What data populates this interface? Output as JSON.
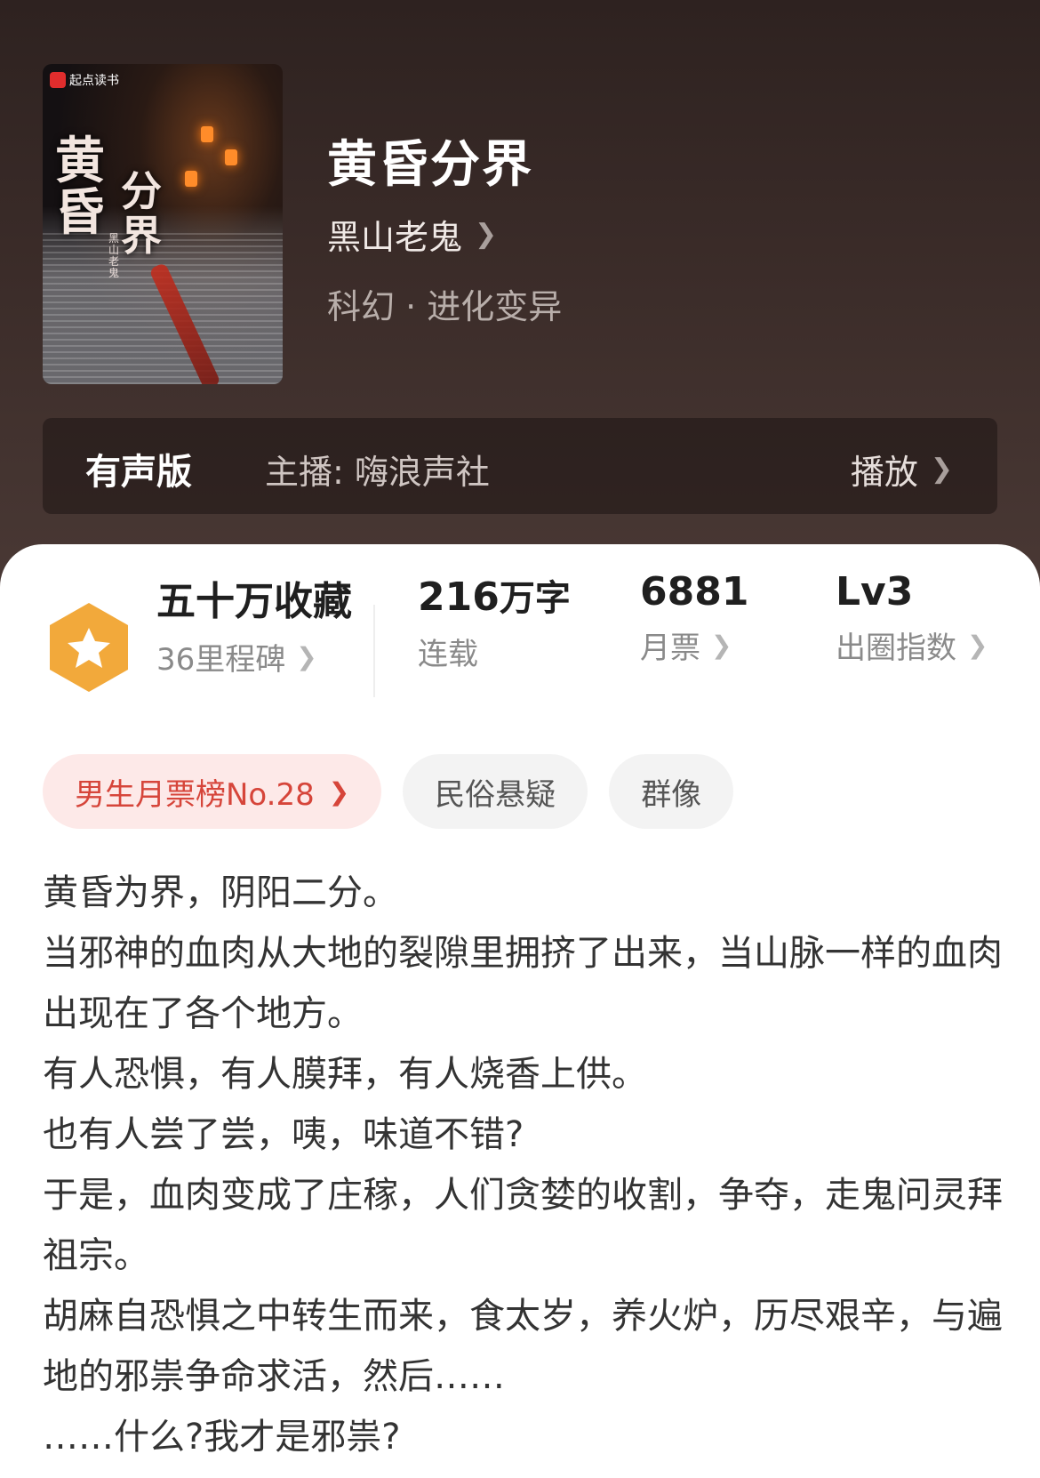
{
  "header": {
    "cover": {
      "badge": "起点读书",
      "title_top": "黄昏",
      "title_bottom": "分界",
      "author": "黑山老鬼"
    },
    "title": "黄昏分界",
    "author": "黑山老鬼",
    "genre": "科幻 · 进化变异",
    "audio": {
      "tag": "有声版",
      "anchor": "主播:  嗨浪声社",
      "play_label": "播放"
    }
  },
  "stats": {
    "collect_value": "五十万收藏",
    "collect_label": "36里程碑",
    "words_value": "216",
    "words_unit": "万字",
    "words_label": "连载",
    "tickets_value": "6881",
    "tickets_label": "月票",
    "level_value": "Lv3",
    "level_label": "出圈指数",
    "badge_color": "#f2a93b"
  },
  "chips": {
    "rank": "男生月票榜No.28",
    "tag1": "民俗悬疑",
    "tag2": "群像"
  },
  "synopsis": [
    "黄昏为界，阴阳二分。",
    "当邪神的血肉从大地的裂隙里拥挤了出来，当山脉一样的血肉出现在了各个地方。",
    "有人恐惧，有人膜拜，有人烧香上供。",
    "也有人尝了尝，咦，味道不错?",
    "于是，血肉变成了庄稼，人们贪婪的收割，争夺，走鬼问灵拜祖宗。",
    "胡麻自恐惧之中转生而来，食太岁，养火炉，历尽艰辛，与遍地的邪祟争命求活，然后……",
    "……什么?我才是邪祟?"
  ]
}
